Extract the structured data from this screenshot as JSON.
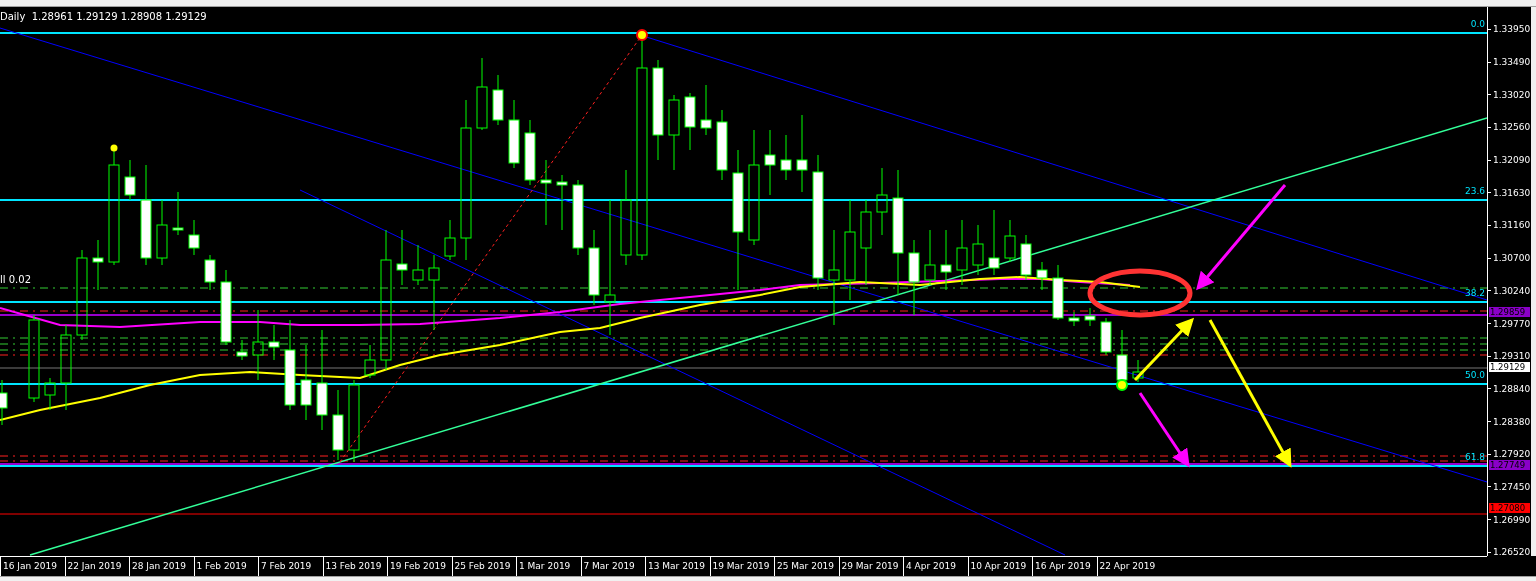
{
  "header": {
    "timeframe": "Daily",
    "quote": "1.28961 1.29129 1.28908 1.29129"
  },
  "fib_levels": [
    {
      "label": "0.0"
    },
    {
      "label": "23.6"
    },
    {
      "label": "38.2"
    },
    {
      "label": "50.0"
    },
    {
      "label": "61.8"
    }
  ],
  "indicator_labels": [
    "ll 0.02"
  ],
  "price_axis": [
    "1.33950",
    "1.33490",
    "1.33020",
    "1.32560",
    "1.32090",
    "1.31630",
    "1.31160",
    "1.30700",
    "1.30240",
    "1.29770",
    "1.29310",
    "1.28840",
    "1.28380",
    "1.27920",
    "1.27450",
    "1.26990",
    "1.26520"
  ],
  "price_tags": [
    {
      "text": "1.29859",
      "color": "#8a00c8"
    },
    {
      "text": "1.29129",
      "color": "#ffffff"
    },
    {
      "text": "1.27749",
      "color": "#8a00c8"
    },
    {
      "text": "1.27080",
      "color": "#ff0000"
    }
  ],
  "time_axis": [
    "16 Jan 2019",
    "22 Jan 2019",
    "28 Jan 2019",
    "1 Feb 2019",
    "7 Feb 2019",
    "13 Feb 2019",
    "19 Feb 2019",
    "25 Feb 2019",
    "1 Mar 2019",
    "7 Mar 2019",
    "13 Mar 2019",
    "19 Mar 2019",
    "25 Mar 2019",
    "29 Mar 2019",
    "4 Apr 2019",
    "10 Apr 2019",
    "16 Apr 2019",
    "22 Apr 2019"
  ]
}
